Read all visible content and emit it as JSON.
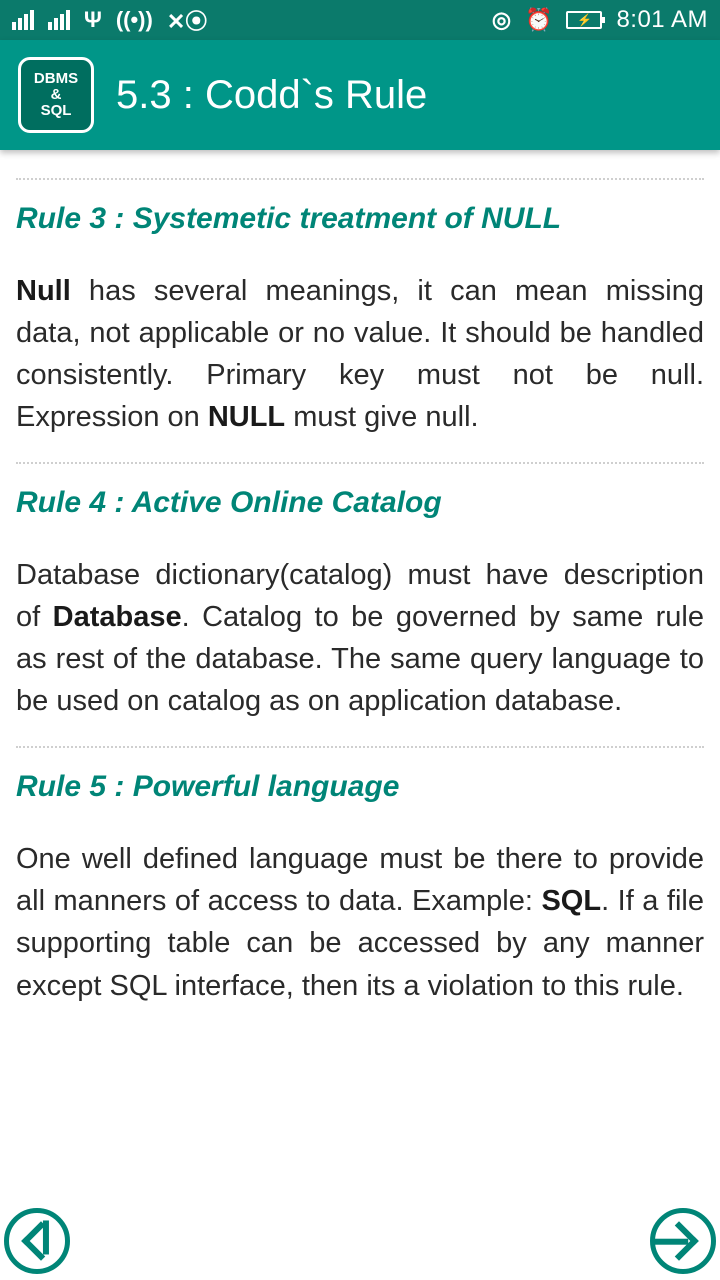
{
  "statusbar": {
    "time": "8:01 AM"
  },
  "appbar": {
    "icon_line1": "DBMS",
    "icon_line2": "&",
    "icon_line3": "SQL",
    "title": "5.3 : Codd`s Rule"
  },
  "rules": [
    {
      "title": "Rule 3 : Systemetic treatment of NULL",
      "body_pre_bold1": "Null",
      "body_mid1": " has several meanings, it can mean missing data, not applicable or no value. It should be handled consistently. Primary key must not be null. Expression on ",
      "body_bold2": "NULL",
      "body_post": " must give null."
    },
    {
      "title": "Rule 4 : Active Online Catalog",
      "body_pre": "Database dictionary(catalog) must have description of ",
      "body_bold1": "Database",
      "body_post": ". Catalog to be governed by same rule as rest of the database. The same query language to be used on catalog as on application database."
    },
    {
      "title": "Rule 5 : Powerful language",
      "body_pre": "One well defined language must be there to provide all manners of access to data. Example: ",
      "body_bold1": "SQL",
      "body_post": ". If a file supporting table can be accessed by any manner except SQL interface, then its a violation to this rule."
    }
  ]
}
